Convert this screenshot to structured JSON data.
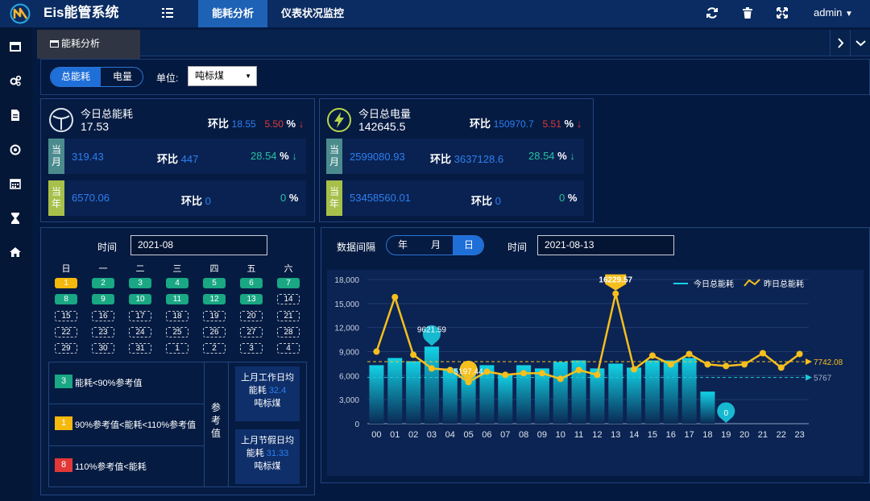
{
  "app": {
    "title": "Eis能管系统"
  },
  "nav": {
    "energy": "能耗分析",
    "meter": "仪表状况监控",
    "user": "admin"
  },
  "tab": {
    "active": "能耗分析"
  },
  "filter": {
    "total": "总能耗",
    "power": "电量",
    "unit_label": "单位:",
    "unit_value": "吨标煤"
  },
  "energy_card": {
    "title": "今日总能耗",
    "value": "17.53",
    "ratio_label": "环比",
    "ratio_value": "18.55",
    "ratio_pct": "5.50",
    "pct": "%",
    "arrow": "↓",
    "month": {
      "tag": "当月",
      "value": "319.43",
      "ratio_label": "环比",
      "ratio_value": "447",
      "pct_value": "28.54",
      "pct": "%",
      "arrow": "↓"
    },
    "year": {
      "tag": "当年",
      "value": "6570.06",
      "ratio_label": "环比",
      "ratio_value": "0",
      "pct_value": "0",
      "pct": "%"
    }
  },
  "power_card": {
    "title": "今日总电量",
    "value": "142645.5",
    "ratio_label": "环比",
    "ratio_value": "150970.7",
    "ratio_pct": "5.51",
    "pct": "%",
    "arrow": "↓",
    "month": {
      "tag": "当月",
      "value": "2599080.93",
      "ratio_label": "环比",
      "ratio_value": "3637128.6",
      "pct_value": "28.54",
      "pct": "%",
      "arrow": "↓"
    },
    "year": {
      "tag": "当年",
      "value": "53458560.01",
      "ratio_label": "环比",
      "ratio_value": "0",
      "pct_value": "0",
      "pct": "%"
    }
  },
  "calendar": {
    "time_label": "时间",
    "month_value": "2021-08",
    "weekdays": [
      "日",
      "一",
      "二",
      "三",
      "四",
      "五",
      "六"
    ],
    "cells": [
      {
        "d": "1",
        "s": "y"
      },
      {
        "d": "2",
        "s": "g"
      },
      {
        "d": "3",
        "s": "g"
      },
      {
        "d": "4",
        "s": "g"
      },
      {
        "d": "5",
        "s": "g"
      },
      {
        "d": "6",
        "s": "g"
      },
      {
        "d": "7",
        "s": "g"
      },
      {
        "d": "8",
        "s": "g"
      },
      {
        "d": "9",
        "s": "g"
      },
      {
        "d": "10",
        "s": "g"
      },
      {
        "d": "11",
        "s": "g"
      },
      {
        "d": "12",
        "s": "g"
      },
      {
        "d": "13",
        "s": "g"
      },
      {
        "d": "14",
        "s": "e"
      },
      {
        "d": "15",
        "s": "e"
      },
      {
        "d": "16",
        "s": "e"
      },
      {
        "d": "17",
        "s": "e"
      },
      {
        "d": "18",
        "s": "e"
      },
      {
        "d": "19",
        "s": "e"
      },
      {
        "d": "20",
        "s": "e"
      },
      {
        "d": "21",
        "s": "e"
      },
      {
        "d": "22",
        "s": "e"
      },
      {
        "d": "23",
        "s": "e"
      },
      {
        "d": "24",
        "s": "e"
      },
      {
        "d": "25",
        "s": "e"
      },
      {
        "d": "26",
        "s": "e"
      },
      {
        "d": "27",
        "s": "e"
      },
      {
        "d": "28",
        "s": "e"
      },
      {
        "d": "29",
        "s": "e"
      },
      {
        "d": "30",
        "s": "e"
      },
      {
        "d": "31",
        "s": "e"
      },
      {
        "d": "1",
        "s": "e"
      },
      {
        "d": "2",
        "s": "e"
      },
      {
        "d": "3",
        "s": "e"
      },
      {
        "d": "4",
        "s": "e"
      }
    ]
  },
  "legend": {
    "items": [
      {
        "badge": "3",
        "text": "能耗<90%参考值",
        "color": "#1aa784"
      },
      {
        "badge": "1",
        "text": "90%参考值<能耗<110%参考值",
        "color": "#f5b80d"
      },
      {
        "badge": "8",
        "text": "110%参考值<能耗",
        "color": "#e23838"
      }
    ],
    "ref_title": "参考值",
    "work_line1": "上月工作日均",
    "work_line2a": "能耗",
    "work_value": "32.4",
    "work_unit": "吨标煤",
    "holiday_line1": "上月节假日均",
    "holiday_line2a": "能耗",
    "holiday_value": "31.33",
    "holiday_unit": "吨标煤"
  },
  "chart_panel": {
    "interval_label": "数据间隔",
    "year": "年",
    "month": "月",
    "day": "日",
    "time_label": "时间",
    "date_value": "2021-08-13"
  },
  "chart_data": {
    "type": "bar",
    "categories": [
      "00",
      "01",
      "02",
      "03",
      "04",
      "05",
      "06",
      "07",
      "08",
      "09",
      "10",
      "11",
      "12",
      "13",
      "14",
      "15",
      "16",
      "17",
      "18",
      "19",
      "20",
      "21",
      "22",
      "23"
    ],
    "series": [
      {
        "name": "今日总能耗",
        "type": "bar",
        "values": [
          7300,
          8200,
          7800,
          9621.59,
          6900,
          6400,
          7300,
          6200,
          7300,
          6900,
          7700,
          7900,
          6900,
          7500,
          7000,
          7900,
          7900,
          8200,
          4000,
          0,
          null,
          null,
          null,
          null
        ]
      },
      {
        "name": "昨日总能耗",
        "type": "line",
        "values": [
          9000,
          15800,
          8600,
          6900,
          6700,
          5197.44,
          6500,
          6100,
          6300,
          6300,
          5600,
          6700,
          6100,
          16229.57,
          6800,
          8500,
          7400,
          8700,
          7400,
          7200,
          7400,
          8800,
          7000,
          8700
        ]
      }
    ],
    "ylim": [
      0,
      18000
    ],
    "yticks": [
      "0",
      "3,000",
      "6,000",
      "9,000",
      "12,000",
      "15,000",
      "18,000"
    ],
    "markers": [
      {
        "label": "9621.59",
        "index": 3,
        "series": 0
      },
      {
        "label": "5197.44",
        "index": 5,
        "series": 1
      },
      {
        "label": "16229.57",
        "index": 13,
        "series": 1
      },
      {
        "label": "0",
        "index": 19,
        "series": 0
      }
    ],
    "avg_lines": [
      {
        "value": 7742.08,
        "label": "7742.08",
        "color": "#f7bf1d"
      },
      {
        "value": 5767,
        "label": "5767",
        "color": "#1ec8d8"
      }
    ],
    "legend_position": "top-right",
    "colors": {
      "bar": "#12d3e6",
      "line": "#f7bf1d"
    }
  }
}
